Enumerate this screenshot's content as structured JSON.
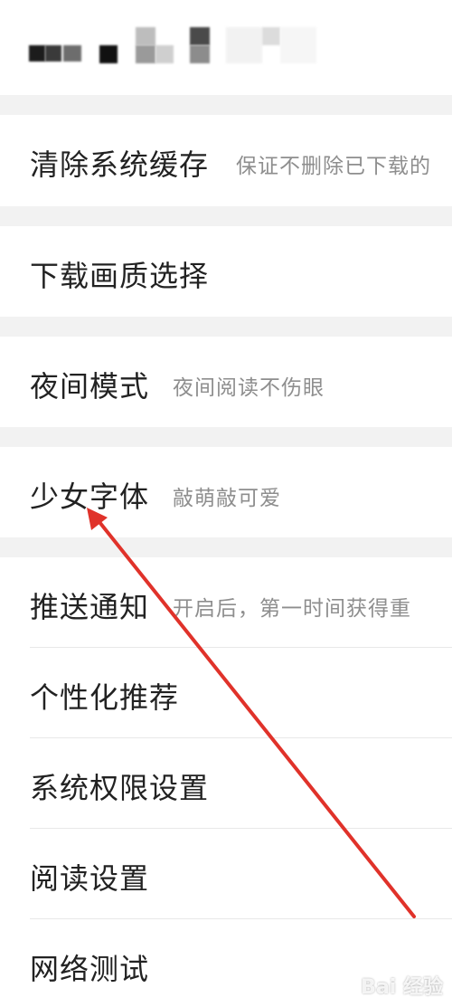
{
  "header": {
    "blurred_title": ""
  },
  "settings": {
    "clear_cache": {
      "title": "清除系统缓存",
      "subtitle": "保证不删除已下载的"
    },
    "download_quality": {
      "title": "下载画质选择"
    },
    "night_mode": {
      "title": "夜间模式",
      "subtitle": "夜间阅读不伤眼"
    },
    "girl_font": {
      "title": "少女字体",
      "subtitle": "敲萌敲可爱"
    },
    "push_notification": {
      "title": "推送通知",
      "subtitle": "开启后，第一时间获得重"
    },
    "personalized_recommendation": {
      "title": "个性化推荐"
    },
    "system_permissions": {
      "title": "系统权限设置"
    },
    "reading_settings": {
      "title": "阅读设置"
    },
    "network_test": {
      "title": "网络测试"
    }
  },
  "annotation": {
    "arrow_color": "#e0322a"
  },
  "watermark": {
    "text": "Bai 经验"
  }
}
